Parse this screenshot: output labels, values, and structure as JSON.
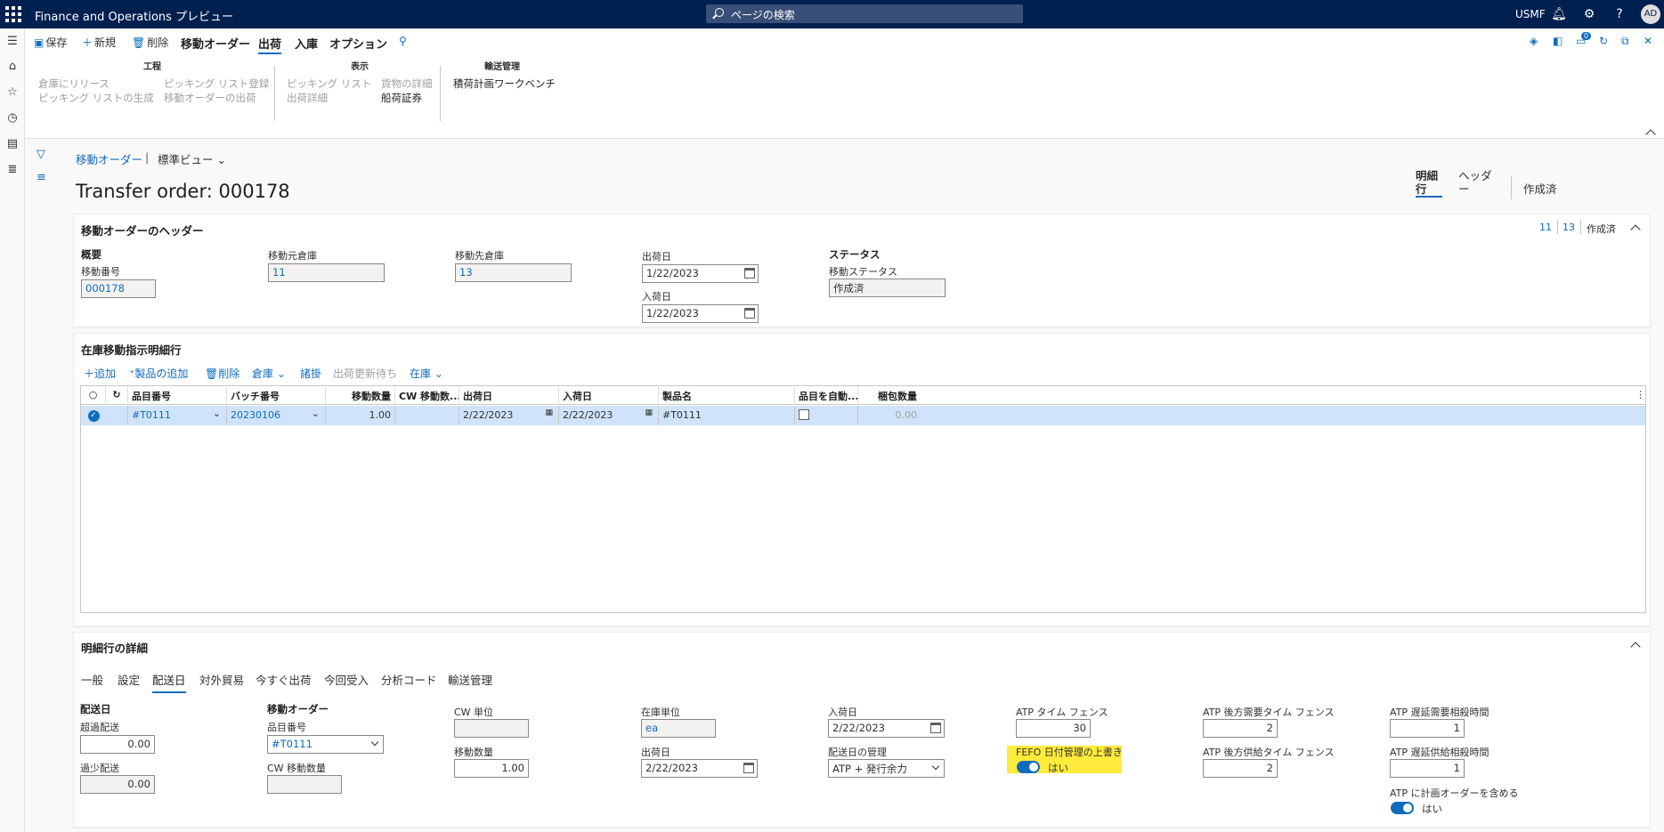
{
  "topbar": {
    "app_title": "Finance and Operations プレビュー",
    "search_placeholder": "ページの検索",
    "company": "USMF",
    "avatar": "AD",
    "icons": [
      "bell-icon",
      "gear-icon",
      "help-icon"
    ]
  },
  "actions": {
    "save": "保存",
    "new": "新規",
    "delete": "削除",
    "tabs": [
      "移動オーダー",
      "出荷",
      "入庫",
      "オプション"
    ],
    "selected_tab": "出荷",
    "badge": "0"
  },
  "ribbon": {
    "group1_title": "工程",
    "group1_items": [
      "倉庫にリリース",
      "ピッキング リストの生成",
      "ピッキング リスト登録",
      "移動オーダーの出荷"
    ],
    "group2_title": "表示",
    "group2_items": [
      "ピッキング リスト",
      "出荷詳細",
      "貨物の詳細",
      "船荷証券"
    ],
    "group3_title": "輸送管理",
    "group3_items": [
      "積荷計画ワークベンチ"
    ]
  },
  "page": {
    "breadcrumb": "移動オーダー",
    "view": "標準ビュー",
    "title": "Transfer order: 000178",
    "right_tab1": "明細行",
    "right_tab2": "ヘッダー",
    "status_right": "作成済"
  },
  "header_section": {
    "title": "移動オーダーのヘッダー",
    "summary_from": "11",
    "summary_to": "13",
    "summary_status": "作成済",
    "overview_label": "概要",
    "order_no_label": "移動番号",
    "order_no": "000178",
    "from_wh_label": "移動元倉庫",
    "from_wh": "11",
    "to_wh_label": "移動先倉庫",
    "to_wh": "13",
    "ship_date_label": "出荷日",
    "ship_date": "1/22/2023",
    "receipt_date_label": "入荷日",
    "receipt_date": "1/22/2023",
    "status_group_label": "ステータス",
    "status_label": "移動ステータス",
    "status": "作成済"
  },
  "lines_section": {
    "title": "在庫移動指示明細行",
    "toolbar": {
      "add": "追加",
      "add_products": "製品の追加",
      "delete": "削除",
      "warehouse": "倉庫",
      "misc": "諸掛",
      "pending": "出荷更新待ち",
      "inventory": "在庫"
    },
    "columns": [
      "品目番号",
      "バッチ番号",
      "移動数量",
      "CW 移動数...",
      "出荷日",
      "入荷日",
      "製品名",
      "品目を自動...",
      "梱包数量"
    ],
    "rows": [
      {
        "item": "#T0111",
        "batch": "20230106",
        "qty": "1.00",
        "cw": "",
        "ship": "2/22/2023",
        "receipt": "2/22/2023",
        "name": "#T0111",
        "auto": "",
        "pack": "0.00"
      }
    ]
  },
  "details_section": {
    "title": "明細行の詳細",
    "tabs": [
      "一般",
      "設定",
      "配送日",
      "対外貿易",
      "今すぐ出荷",
      "今回受入",
      "分析コード",
      "輸送管理"
    ],
    "selected_tab": "配送日",
    "delivery_label": "配送日",
    "over_label": "超過配送",
    "over": "0.00",
    "under_label": "過少配送",
    "under": "0.00",
    "order_label": "移動オーダー",
    "item_label": "品目番号",
    "item": "#T0111",
    "cw_qty_label": "CW 移動数量",
    "cw_qty": "",
    "cw_unit_label": "CW 単位",
    "cw_unit": "",
    "qty_label": "移動数量",
    "qty": "1.00",
    "unit_label": "在庫単位",
    "unit": "ea",
    "ship_label": "出荷日",
    "ship": "2/22/2023",
    "receipt_label": "入荷日",
    "receipt": "2/22/2023",
    "mgmt_label": "配送日の管理",
    "mgmt": "ATP + 発行余力",
    "atp_fence_label": "ATP タイム フェンス",
    "atp_fence": "30",
    "fefo_label": "FEFO 日付管理の上書き",
    "fefo": "はい",
    "back_demand_label": "ATP 後方需要タイム フェンス",
    "back_demand": "2",
    "back_supply_label": "ATP 後方供給タイム フェンス",
    "back_supply": "2",
    "delay_demand_label": "ATP 遅延需要相殺時間",
    "delay_demand": "1",
    "delay_supply_label": "ATP 遅延供給相殺時間",
    "delay_supply": "1",
    "include_planned_label": "ATP に計画オーダーを含める",
    "include_planned": "はい"
  }
}
